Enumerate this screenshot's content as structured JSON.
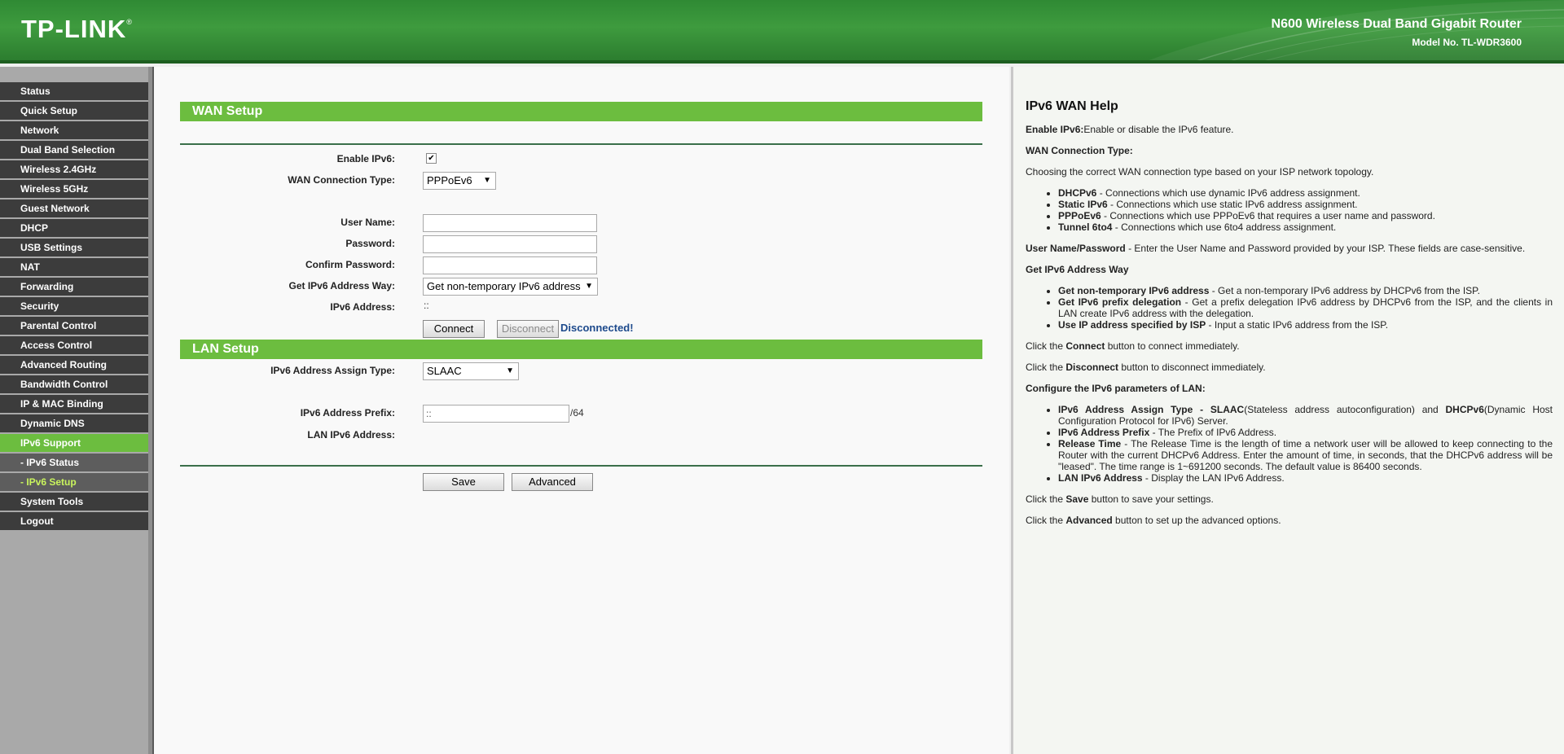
{
  "header": {
    "logo": "TP-LINK",
    "logo_mark": "®",
    "product": "N600 Wireless Dual Band Gigabit Router",
    "model": "Model No. TL-WDR3600"
  },
  "sidebar": {
    "items": [
      {
        "label": "Status"
      },
      {
        "label": "Quick Setup"
      },
      {
        "label": "Network"
      },
      {
        "label": "Dual Band Selection"
      },
      {
        "label": "Wireless 2.4GHz"
      },
      {
        "label": "Wireless 5GHz"
      },
      {
        "label": "Guest Network"
      },
      {
        "label": "DHCP"
      },
      {
        "label": "USB Settings"
      },
      {
        "label": "NAT"
      },
      {
        "label": "Forwarding"
      },
      {
        "label": "Security"
      },
      {
        "label": "Parental Control"
      },
      {
        "label": "Access Control"
      },
      {
        "label": "Advanced Routing"
      },
      {
        "label": "Bandwidth Control"
      },
      {
        "label": "IP & MAC Binding"
      },
      {
        "label": "Dynamic DNS"
      },
      {
        "label": "IPv6 Support"
      },
      {
        "label": "- IPv6 Status"
      },
      {
        "label": "- IPv6 Setup"
      },
      {
        "label": "System Tools"
      },
      {
        "label": "Logout"
      }
    ],
    "active": "IPv6 Support",
    "current_sub": "- IPv6 Setup"
  },
  "wan": {
    "title": "WAN Setup",
    "enable_label": "Enable IPv6:",
    "enable_checked": true,
    "enable_mark": "✔",
    "conn_type_label": "WAN Connection Type:",
    "conn_type_value": "PPPoEv6",
    "username_label": "User Name:",
    "username_value": "",
    "password_label": "Password:",
    "password_value": "",
    "confirm_label": "Confirm Password:",
    "confirm_value": "",
    "addr_way_label": "Get IPv6 Address Way:",
    "addr_way_value": "Get non-temporary IPv6 address",
    "ipv6_addr_label": "IPv6 Address:",
    "ipv6_addr_value": "::",
    "connect_label": "Connect",
    "disconnect_label": "Disconnect",
    "status": "Disconnected!"
  },
  "lan": {
    "title": "LAN Setup",
    "assign_type_label": "IPv6 Address Assign Type:",
    "assign_type_value": "SLAAC",
    "prefix_label": "IPv6 Address Prefix:",
    "prefix_value": "::",
    "prefix_suffix": "/64",
    "lan_addr_label": "LAN IPv6 Address:",
    "lan_addr_value": ""
  },
  "actions": {
    "save_label": "Save",
    "advanced_label": "Advanced"
  },
  "help": {
    "title": "IPv6 WAN Help",
    "enable_term": "Enable IPv6:",
    "enable_desc": "Enable or disable the IPv6 feature.",
    "wan_type_heading": "WAN Connection Type:",
    "wan_type_intro": "Choosing the correct WAN connection type based on your ISP network topology.",
    "wan_types": [
      {
        "term": "DHCPv6",
        "desc": " - Connections which use dynamic IPv6 address assignment."
      },
      {
        "term": "Static IPv6",
        "desc": " - Connections which use static IPv6 address assignment."
      },
      {
        "term": "PPPoEv6",
        "desc": " - Connections which use PPPoEv6 that requires a user name and password."
      },
      {
        "term": "Tunnel 6to4",
        "desc": " - Connections which use 6to4 address assignment."
      }
    ],
    "userpass_term": "User Name/Password",
    "userpass_desc": " - Enter the User Name and Password provided by your ISP. These fields are case-sensitive.",
    "addr_way_heading": "Get IPv6 Address Way",
    "addr_ways": [
      {
        "term": "Get non-temporary IPv6 address",
        "desc": " - Get a non-temporary IPv6 address by DHCPv6 from the ISP."
      },
      {
        "term": "Get IPv6 prefix delegation",
        "desc": " - Get a prefix delegation IPv6 address by DHCPv6 from the ISP, and the clients in LAN create IPv6 address with the delegation."
      },
      {
        "term": "Use IP address specified by ISP",
        "desc": " - Input a static IPv6 address from the ISP."
      }
    ],
    "connect_pre": "Click the ",
    "connect_term": "Connect",
    "connect_post": " button to connect immediately.",
    "disconnect_pre": "Click the ",
    "disconnect_term": "Disconnect",
    "disconnect_post": " button to disconnect immediately.",
    "lan_heading": "Configure the IPv6 parameters of LAN:",
    "lan_items": [
      {
        "term": "IPv6 Address Assign Type - SLAAC",
        "desc": "(Stateless address autoconfiguration) and ",
        "term2": "DHCPv6",
        "desc2": "(Dynamic Host Configuration Protocol for IPv6) Server."
      },
      {
        "term": "IPv6 Address Prefix",
        "desc": " - The Prefix of IPv6 Address.",
        "term2": "",
        "desc2": ""
      },
      {
        "term": "Release Time",
        "desc": " - The Release Time is the length of time a network user will be allowed to keep connecting to the Router with the current DHCPv6 Address. Enter the amount of time, in seconds, that the DHCPv6 address will be \"leased\". The time range is 1~691200 seconds. The default value is 86400 seconds.",
        "term2": "",
        "desc2": ""
      },
      {
        "term": "LAN IPv6 Address",
        "desc": " - Display the LAN IPv6 Address.",
        "term2": "",
        "desc2": ""
      }
    ],
    "save_pre": "Click the ",
    "save_term": "Save",
    "save_post": " button to save your settings.",
    "advanced_pre": "Click the ",
    "advanced_term": "Advanced",
    "advanced_post": " button to set up the advanced options."
  }
}
